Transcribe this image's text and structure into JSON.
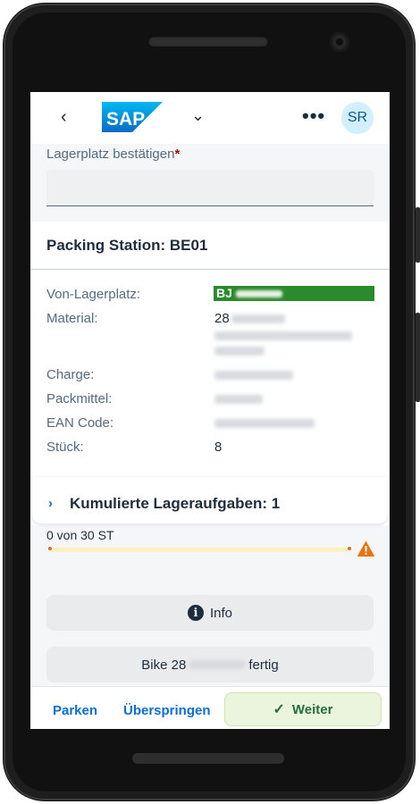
{
  "header": {
    "back_icon": "chevron-left-icon",
    "logo_text": "SAP",
    "menu_icon": "chevron-down-icon",
    "overflow_icon": "overflow-icon",
    "avatar_initials": "SR"
  },
  "confirm": {
    "label": "Lagerplatz bestätigen",
    "required_mark": "*",
    "value": ""
  },
  "details": {
    "title": "Packing Station: BE01",
    "rows": [
      {
        "label": "Von-Lagerplatz:",
        "value": "BJ"
      },
      {
        "label": "Material:",
        "value": "28"
      },
      {
        "label": "Charge:",
        "value": ""
      },
      {
        "label": "Packmittel:",
        "value": ""
      },
      {
        "label": "EAN Code:",
        "value": ""
      },
      {
        "label": "Stück:",
        "value": "8"
      }
    ],
    "von_lagerplatz_color": "#2b8a2b"
  },
  "cumulative": {
    "title": "Kumulierte Lageraufgaben: 1",
    "icon": "chevron-right-icon"
  },
  "progress": {
    "text": "0 von 30 ST",
    "value": 0,
    "total": 30,
    "status_icon": "warning-icon",
    "status_color": "#e9730c"
  },
  "buttons": {
    "info_label": "Info",
    "info_icon": "info-icon",
    "bike_prefix": "Bike 28",
    "bike_suffix": "fertig"
  },
  "footer": {
    "parken_label": "Parken",
    "ueberspringen_label": "Überspringen",
    "weiter_label": "Weiter",
    "weiter_icon": "checkmark-icon"
  }
}
